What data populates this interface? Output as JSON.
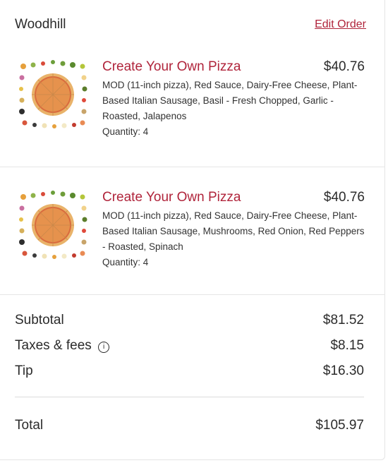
{
  "header": {
    "store_name": "Woodhill",
    "edit_order_label": "Edit Order"
  },
  "items": [
    {
      "title": "Create Your Own Pizza",
      "price": "$40.76",
      "description": "MOD (11-inch pizza), Red Sauce, Dairy-Free Cheese, Plant-Based Italian Sausage, Basil - Fresh Chopped, Garlic - Roasted, Jalapenos",
      "quantity": "Quantity: 4"
    },
    {
      "title": "Create Your Own Pizza",
      "price": "$40.76",
      "description": "MOD (11-inch pizza), Red Sauce, Dairy-Free Cheese, Plant-Based Italian Sausage, Mushrooms, Red Onion, Red Peppers - Roasted, Spinach",
      "quantity": "Quantity: 4"
    }
  ],
  "summary": {
    "subtotal_label": "Subtotal",
    "subtotal_value": "$81.52",
    "taxes_label": "Taxes & fees",
    "taxes_value": "$8.15",
    "tip_label": "Tip",
    "tip_value": "$16.30",
    "total_label": "Total",
    "total_value": "$105.97"
  },
  "colors": {
    "accent": "#b0243b",
    "text": "#2b2b2b"
  },
  "icons": {
    "info": "info-circle-icon",
    "pizza": "pizza-toppings-image"
  }
}
